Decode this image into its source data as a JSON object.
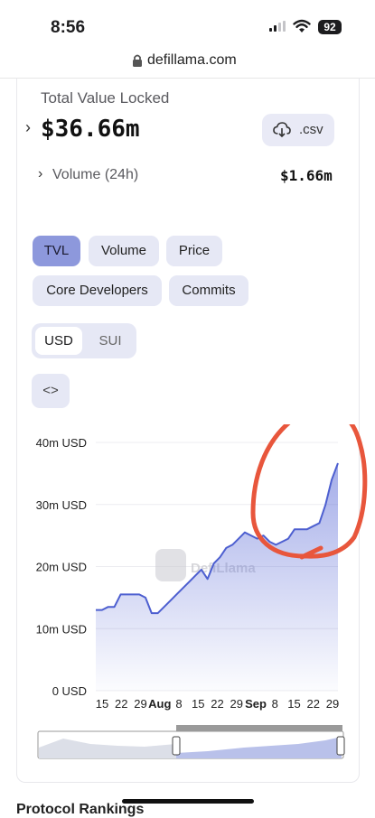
{
  "status_bar": {
    "time": "8:56",
    "battery": "92"
  },
  "browser": {
    "url": "defillama.com"
  },
  "summary": {
    "tvl_label": "Total Value Locked",
    "tvl_value": "$36.66m",
    "csv_label": ".csv",
    "volume_label": "Volume (24h)",
    "volume_value": "$1.66m"
  },
  "metric_tabs": [
    "TVL",
    "Volume",
    "Price",
    "Core Developers",
    "Commits"
  ],
  "active_metric": "TVL",
  "denomination": {
    "options": [
      "USD",
      "SUI"
    ],
    "selected": "USD"
  },
  "embed_label": "<>",
  "watermark": "DefiLlama",
  "bottom_section_label": "Protocol Rankings",
  "colors": {
    "accent": "#4d5fd0",
    "annotation": "#e8563c",
    "active_pill": "#8d98dc",
    "pill": "#e6e8f5"
  },
  "chart_data": {
    "type": "area",
    "series": [
      {
        "values": [
          13,
          13,
          13.5,
          13.5,
          15.5,
          15.5,
          15.5,
          15.5,
          15,
          12.5,
          12.5,
          13.5,
          14.5,
          15.5,
          16.5,
          17.5,
          18.5,
          19.5,
          18,
          20.5,
          21.5,
          23,
          23.5,
          24.5,
          25.5,
          25,
          24.5,
          25,
          24,
          23.5,
          24,
          24.5,
          26,
          26,
          26,
          26.5,
          27,
          30,
          34,
          36.66
        ]
      }
    ],
    "x_tick_labels": [
      "15",
      "22",
      "29",
      "Aug",
      "8",
      "15",
      "22",
      "29",
      "Sep",
      "8",
      "15",
      "22",
      "29"
    ],
    "y_tick_labels": [
      "0 USD",
      "10m USD",
      "20m USD",
      "30m USD",
      "40m USD"
    ],
    "ylim": [
      0,
      40000000
    ],
    "grid": true
  }
}
